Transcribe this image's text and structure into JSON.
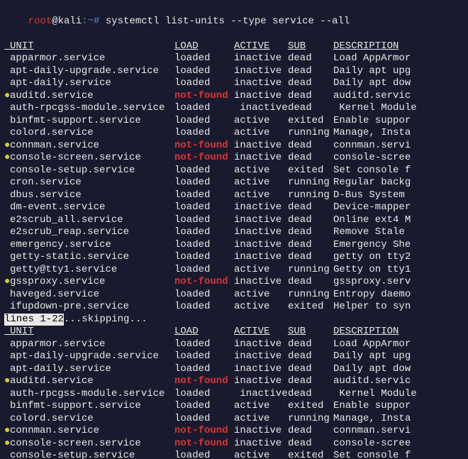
{
  "prompt": {
    "user": "root",
    "at": "@",
    "host": "kali",
    "path": ":~#",
    "command": " systemctl list-units --type service --all"
  },
  "headers": {
    "unit": "UNIT",
    "load": "LOAD",
    "active": "ACTIVE",
    "sub": "SUB",
    "description": "DESCRIPTION"
  },
  "rows1": [
    {
      "bullet": "",
      "unit": "apparmor.service",
      "load": "loaded",
      "active": "inactive",
      "sub": "dead",
      "desc": "Load AppArmor"
    },
    {
      "bullet": "",
      "unit": "apt-daily-upgrade.service",
      "load": "loaded",
      "active": "inactive",
      "sub": "dead",
      "desc": "Daily apt upg"
    },
    {
      "bullet": "",
      "unit": "apt-daily.service",
      "load": "loaded",
      "active": "inactive",
      "sub": "dead",
      "desc": "Daily apt dow"
    },
    {
      "bullet": "●",
      "bulletColor": "yellow",
      "unit": "auditd.service",
      "load": "not-found",
      "active": "inactive",
      "sub": "dead",
      "desc": "auditd.servic"
    },
    {
      "bullet": "",
      "unit": "auth-rpcgss-module.service",
      "load": "loaded",
      "active": " inactive",
      "sub": "dead",
      "desc": " Kernel Module"
    },
    {
      "bullet": "",
      "unit": "binfmt-support.service",
      "load": "loaded",
      "active": "active",
      "sub": "exited",
      "desc": "Enable suppor"
    },
    {
      "bullet": "",
      "unit": "colord.service",
      "load": "loaded",
      "active": "active",
      "sub": "running",
      "desc": "Manage, Insta"
    },
    {
      "bullet": "●",
      "bulletColor": "yellow",
      "unit": "connman.service",
      "load": "not-found",
      "active": "inactive",
      "sub": "dead",
      "desc": "connman.servi"
    },
    {
      "bullet": "●",
      "bulletColor": "yellow",
      "unit": "console-screen.service",
      "load": "not-found",
      "active": "inactive",
      "sub": "dead",
      "desc": "console-scree"
    },
    {
      "bullet": "",
      "unit": "console-setup.service",
      "load": "loaded",
      "active": "active",
      "sub": "exited",
      "desc": "Set console f"
    },
    {
      "bullet": "",
      "unit": "cron.service",
      "load": "loaded",
      "active": "active",
      "sub": "running",
      "desc": "Regular backg"
    },
    {
      "bullet": "",
      "unit": "dbus.service",
      "load": "loaded",
      "active": "active",
      "sub": "running",
      "desc": "D-Bus System "
    },
    {
      "bullet": "",
      "unit": "dm-event.service",
      "load": "loaded",
      "active": "inactive",
      "sub": "dead",
      "desc": "Device-mapper"
    },
    {
      "bullet": "",
      "unit": "e2scrub_all.service",
      "load": "loaded",
      "active": "inactive",
      "sub": "dead",
      "desc": "Online ext4 M"
    },
    {
      "bullet": "",
      "unit": "e2scrub_reap.service",
      "load": "loaded",
      "active": "inactive",
      "sub": "dead",
      "desc": "Remove Stale "
    },
    {
      "bullet": "",
      "unit": "emergency.service",
      "load": "loaded",
      "active": "inactive",
      "sub": "dead",
      "desc": "Emergency She"
    },
    {
      "bullet": "",
      "unit": "getty-static.service",
      "load": "loaded",
      "active": "inactive",
      "sub": "dead",
      "desc": "getty on tty2"
    },
    {
      "bullet": "",
      "unit": "getty@tty1.service",
      "load": "loaded",
      "active": "active",
      "sub": "running",
      "desc": "Getty on tty1"
    },
    {
      "bullet": "●",
      "bulletColor": "yellow",
      "unit": "gssproxy.service",
      "load": "not-found",
      "active": "inactive",
      "sub": "dead",
      "desc": "gssproxy.serv"
    },
    {
      "bullet": "",
      "unit": "haveged.service",
      "load": "loaded",
      "active": "active",
      "sub": "running",
      "desc": "Entropy daemo"
    },
    {
      "bullet": "",
      "unit": "ifupdown-pre.service",
      "load": "loaded",
      "active": "active",
      "sub": "exited",
      "desc": "Helper to syn"
    }
  ],
  "pager": {
    "highlight": "lines 1-22",
    "rest": "...skipping..."
  },
  "rows2": [
    {
      "bullet": "",
      "unit": "apparmor.service",
      "load": "loaded",
      "active": "inactive",
      "sub": "dead",
      "desc": "Load AppArmor"
    },
    {
      "bullet": "",
      "unit": "apt-daily-upgrade.service",
      "load": "loaded",
      "active": "inactive",
      "sub": "dead",
      "desc": "Daily apt upg"
    },
    {
      "bullet": "",
      "unit": "apt-daily.service",
      "load": "loaded",
      "active": "inactive",
      "sub": "dead",
      "desc": "Daily apt dow"
    },
    {
      "bullet": "●",
      "bulletColor": "yellow",
      "unit": "auditd.service",
      "load": "not-found",
      "active": "inactive",
      "sub": "dead",
      "desc": "auditd.servic"
    },
    {
      "bullet": "",
      "unit": "auth-rpcgss-module.service",
      "load": "loaded",
      "active": " inactive",
      "sub": "dead",
      "desc": " Kernel Module"
    },
    {
      "bullet": "",
      "unit": "binfmt-support.service",
      "load": "loaded",
      "active": "active",
      "sub": "exited",
      "desc": "Enable suppor"
    },
    {
      "bullet": "",
      "unit": "colord.service",
      "load": "loaded",
      "active": "active",
      "sub": "running",
      "desc": "Manage, Insta"
    },
    {
      "bullet": "●",
      "bulletColor": "yellow",
      "unit": "connman.service",
      "load": "not-found",
      "active": "inactive",
      "sub": "dead",
      "desc": "connman.servi"
    },
    {
      "bullet": "●",
      "bulletColor": "yellow",
      "unit": "console-screen.service",
      "load": "not-found",
      "active": "inactive",
      "sub": "dead",
      "desc": "console-scree"
    },
    {
      "bullet": "",
      "unit": "console-setup.service",
      "load": "loaded",
      "active": "active",
      "sub": "exited",
      "desc": "Set console f"
    }
  ]
}
